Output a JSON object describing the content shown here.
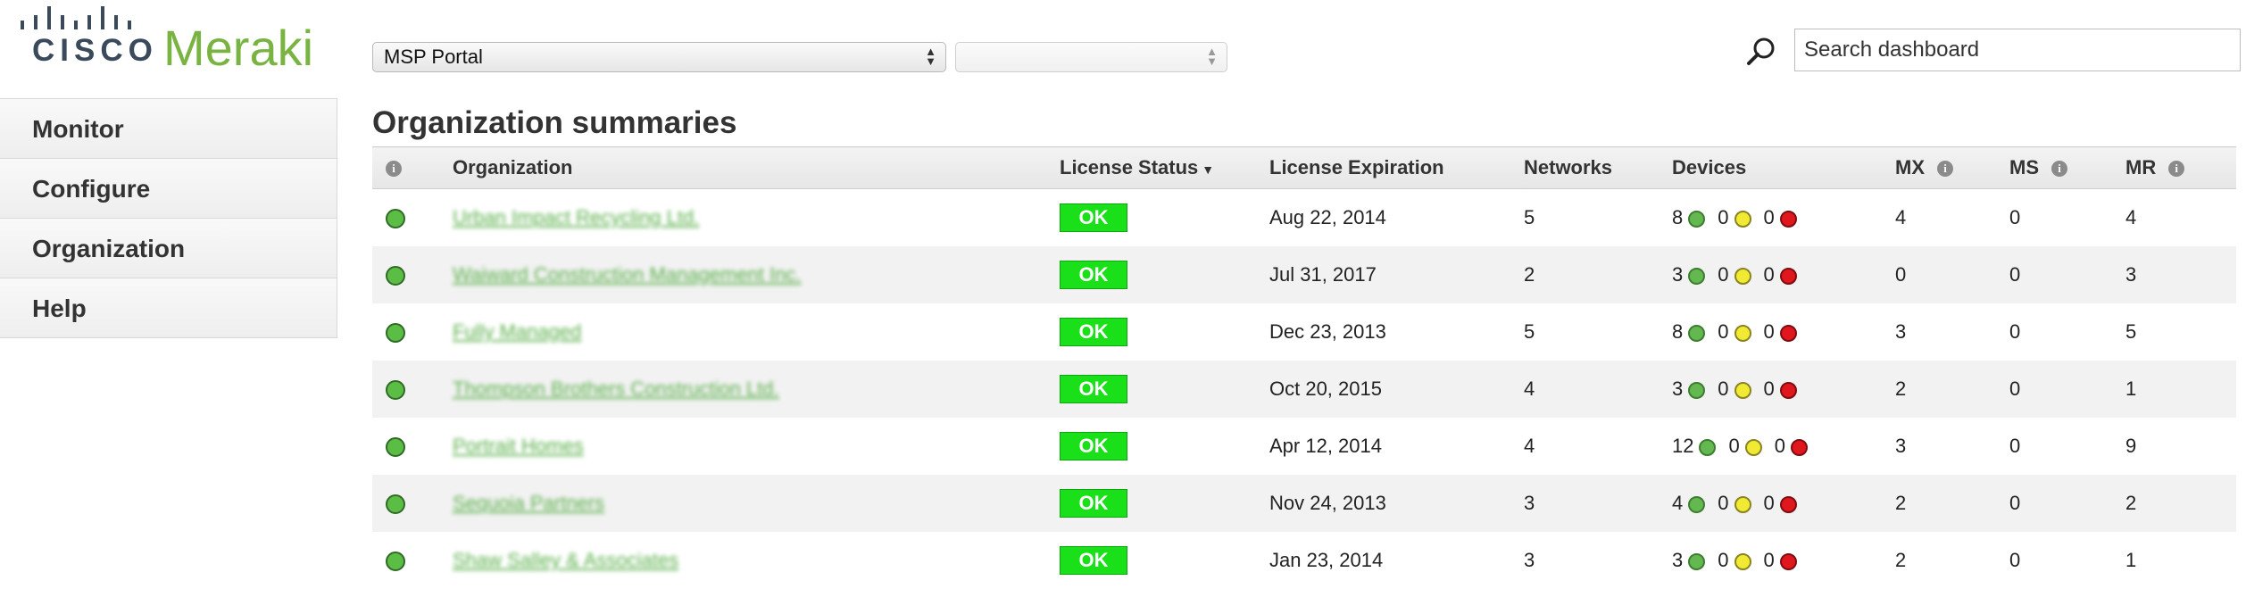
{
  "logo": {
    "cisco": "CISCO",
    "meraki": "Meraki"
  },
  "colors": {
    "brand_green": "#79b443",
    "ok_green": "#19e019",
    "status_green": "#5bbd46",
    "status_yellow": "#f0ea34",
    "status_red": "#e0181e"
  },
  "org_select": {
    "value": "MSP Portal",
    "network_value": ""
  },
  "search": {
    "placeholder": "Search dashboard",
    "icon": "search-icon"
  },
  "sidebar": {
    "items": [
      {
        "label": "Monitor"
      },
      {
        "label": "Configure"
      },
      {
        "label": "Organization"
      },
      {
        "label": "Help"
      }
    ]
  },
  "page": {
    "title": "Organization summaries"
  },
  "table": {
    "columns": {
      "organization": "Organization",
      "license_status": "License Status",
      "sort_indicator": "▼",
      "license_expiration": "License Expiration",
      "networks": "Networks",
      "devices": "Devices",
      "mx": "MX",
      "ms": "MS",
      "mr": "MR"
    },
    "rows": [
      {
        "org": "Urban Impact Recycling Ltd.",
        "status": "OK",
        "expiration": "Aug 22, 2014",
        "networks": "5",
        "online": "8",
        "alerting": "0",
        "offline": "0",
        "mx": "4",
        "ms": "0",
        "mr": "4"
      },
      {
        "org": "Waiward Construction Management Inc.",
        "status": "OK",
        "expiration": "Jul 31, 2017",
        "networks": "2",
        "online": "3",
        "alerting": "0",
        "offline": "0",
        "mx": "0",
        "ms": "0",
        "mr": "3"
      },
      {
        "org": "Fully Managed",
        "status": "OK",
        "expiration": "Dec 23, 2013",
        "networks": "5",
        "online": "8",
        "alerting": "0",
        "offline": "0",
        "mx": "3",
        "ms": "0",
        "mr": "5"
      },
      {
        "org": "Thompson Brothers Construction Ltd.",
        "status": "OK",
        "expiration": "Oct 20, 2015",
        "networks": "4",
        "online": "3",
        "alerting": "0",
        "offline": "0",
        "mx": "2",
        "ms": "0",
        "mr": "1"
      },
      {
        "org": "Portrait Homes",
        "status": "OK",
        "expiration": "Apr 12, 2014",
        "networks": "4",
        "online": "12",
        "alerting": "0",
        "offline": "0",
        "mx": "3",
        "ms": "0",
        "mr": "9"
      },
      {
        "org": "Sequoia Partners",
        "status": "OK",
        "expiration": "Nov 24, 2013",
        "networks": "3",
        "online": "4",
        "alerting": "0",
        "offline": "0",
        "mx": "2",
        "ms": "0",
        "mr": "2"
      },
      {
        "org": "Shaw Salley & Associates",
        "status": "OK",
        "expiration": "Jan 23, 2014",
        "networks": "3",
        "online": "3",
        "alerting": "0",
        "offline": "0",
        "mx": "2",
        "ms": "0",
        "mr": "1"
      }
    ]
  }
}
